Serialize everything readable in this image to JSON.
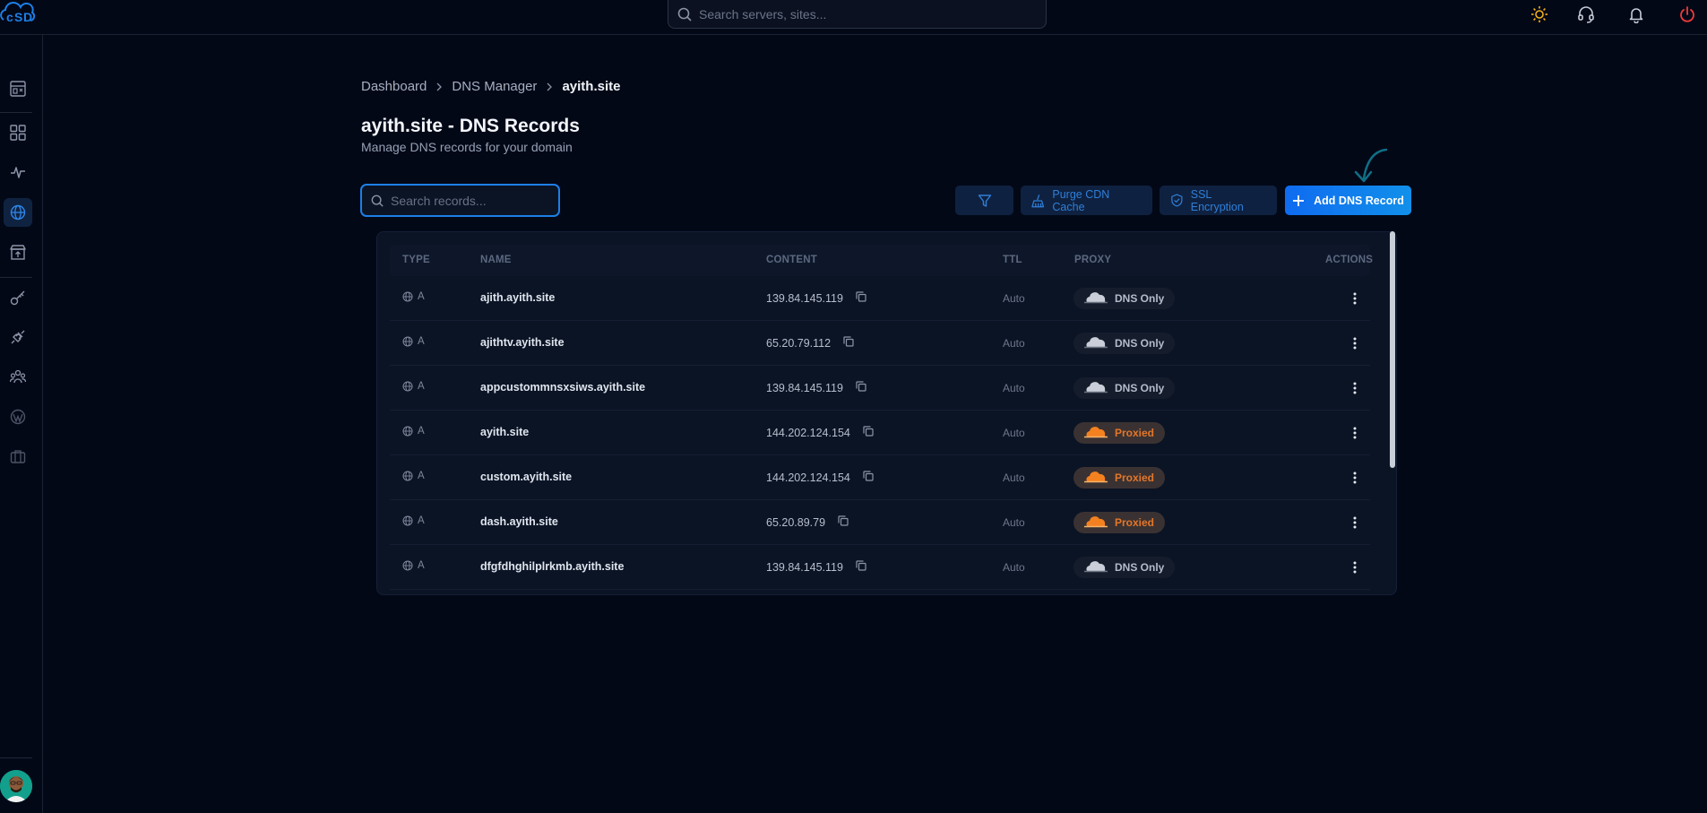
{
  "topbar": {
    "search_placeholder": "Search servers, sites..."
  },
  "breadcrumb": {
    "items": [
      "Dashboard",
      "DNS Manager"
    ],
    "current": "ayith.site"
  },
  "page": {
    "title": "ayith.site - DNS Records",
    "subtitle": "Manage DNS records for your domain"
  },
  "toolbar": {
    "search_placeholder": "Search records...",
    "purge_label": "Purge CDN Cache",
    "ssl_label": "SSL Encryption",
    "add_label": "Add DNS Record"
  },
  "table": {
    "headers": {
      "type": "TYPE",
      "name": "NAME",
      "content": "CONTENT",
      "ttl": "TTL",
      "proxy": "PROXY",
      "actions": "ACTIONS"
    },
    "rows": [
      {
        "type": "A",
        "name": "ajith.ayith.site",
        "content": "139.84.145.119",
        "ttl": "Auto",
        "proxy": "DNS Only"
      },
      {
        "type": "A",
        "name": "ajithtv.ayith.site",
        "content": "65.20.79.112",
        "ttl": "Auto",
        "proxy": "DNS Only"
      },
      {
        "type": "A",
        "name": "appcustommnsxsiws.ayith.site",
        "content": "139.84.145.119",
        "ttl": "Auto",
        "proxy": "DNS Only"
      },
      {
        "type": "A",
        "name": "ayith.site",
        "content": "144.202.124.154",
        "ttl": "Auto",
        "proxy": "Proxied"
      },
      {
        "type": "A",
        "name": "custom.ayith.site",
        "content": "144.202.124.154",
        "ttl": "Auto",
        "proxy": "Proxied"
      },
      {
        "type": "A",
        "name": "dash.ayith.site",
        "content": "65.20.89.79",
        "ttl": "Auto",
        "proxy": "Proxied"
      },
      {
        "type": "A",
        "name": "dfgfdhghilplrkmb.ayith.site",
        "content": "139.84.145.119",
        "ttl": "Auto",
        "proxy": "DNS Only"
      }
    ]
  },
  "colors": {
    "accent": "#1d7fe6",
    "proxied": "#e2762a",
    "background": "#030817"
  }
}
